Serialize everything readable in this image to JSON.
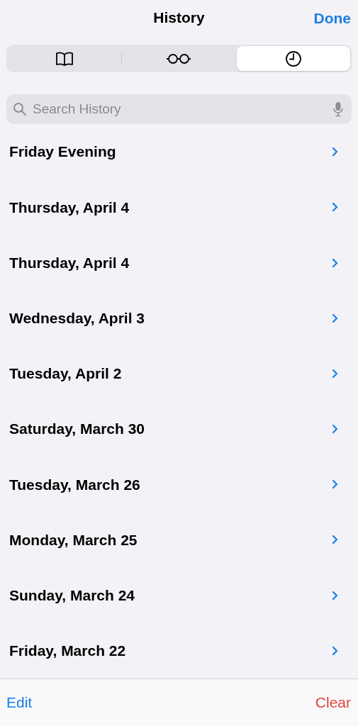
{
  "header": {
    "title": "History",
    "done_button": "Done"
  },
  "tabs": [
    {
      "selected": false
    },
    {
      "selected": false
    },
    {
      "selected": true
    }
  ],
  "search": {
    "placeholder": "Search History"
  },
  "history_groups": [
    {
      "label": "Friday Evening"
    },
    {
      "label": "Thursday, April 4"
    },
    {
      "label": "Thursday, April 4"
    },
    {
      "label": "Wednesday, April 3"
    },
    {
      "label": "Tuesday, April 2"
    },
    {
      "label": "Saturday, March 30"
    },
    {
      "label": "Tuesday, March 26"
    },
    {
      "label": "Monday, March 25"
    },
    {
      "label": "Sunday, March 24"
    },
    {
      "label": "Friday, March 22"
    }
  ],
  "toolbar": {
    "edit_button": "Edit",
    "clear_button": "Clear"
  }
}
